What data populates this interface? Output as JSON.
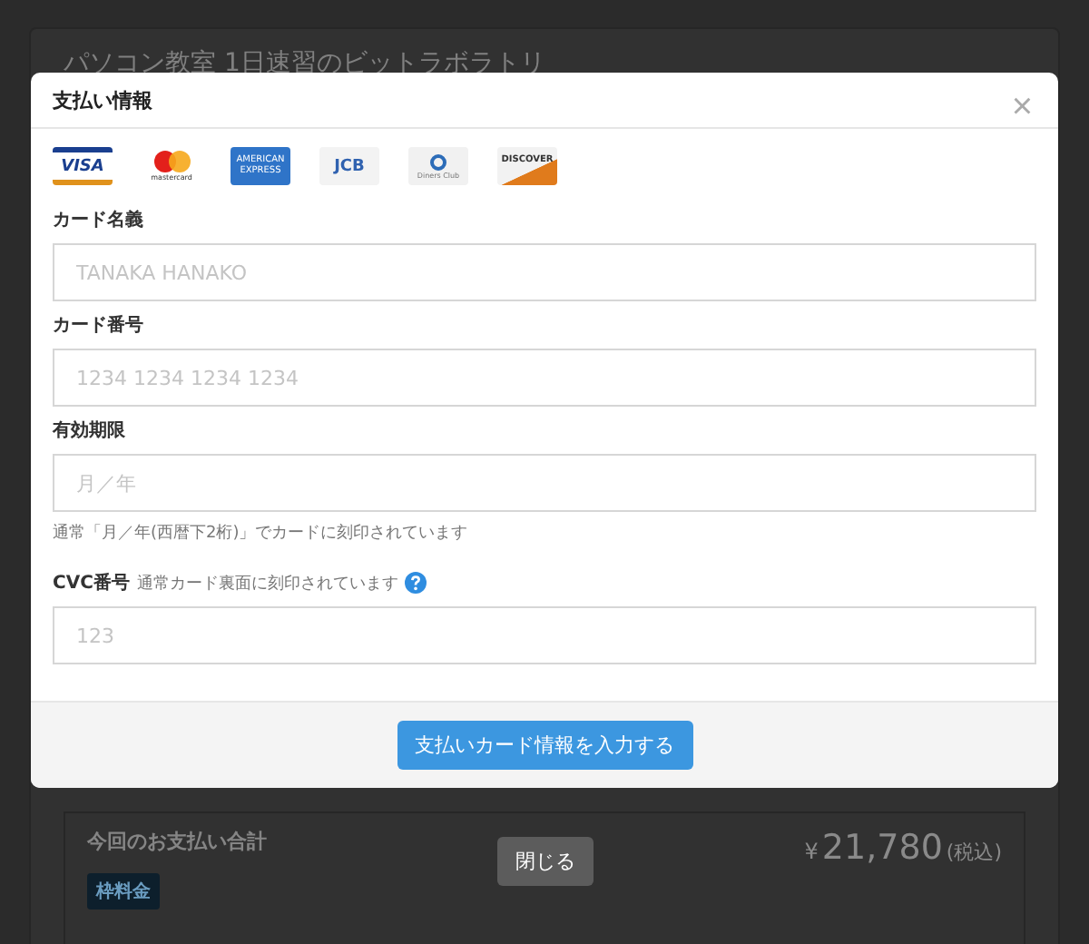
{
  "page": {
    "title": "パソコン教室 1日速習のビットラボラトリ",
    "total_label": "今回のお支払い合計",
    "badge": "枠料金",
    "currency": "¥",
    "amount": "21,780",
    "tax_note": "(税込)"
  },
  "modal": {
    "title": "支払い情報",
    "close": "×",
    "cards": [
      {
        "kind": "visa",
        "label": "VISA"
      },
      {
        "kind": "mastercard",
        "label": "mastercard"
      },
      {
        "kind": "amex",
        "label": "AMERICAN EXPRESS"
      },
      {
        "kind": "jcb",
        "label": "JCB"
      },
      {
        "kind": "diners",
        "label": "Diners Club"
      },
      {
        "kind": "discover",
        "label": "DISCOVER"
      }
    ],
    "fields": [
      {
        "label": "カード名義",
        "placeholder": "TANAKA HANAKO"
      },
      {
        "label": "カード番号",
        "placeholder": "1234 1234 1234 1234"
      },
      {
        "label": "有効期限",
        "placeholder": "月／年",
        "help": "通常「月／年(西暦下2桁)」でカードに刻印されています"
      },
      {
        "label": "CVC番号",
        "note": "通常カード裏面に刻印されています",
        "info_icon": true,
        "placeholder": "123"
      }
    ],
    "submit": "支払いカード情報を入力する"
  },
  "close_button": "閉じる"
}
